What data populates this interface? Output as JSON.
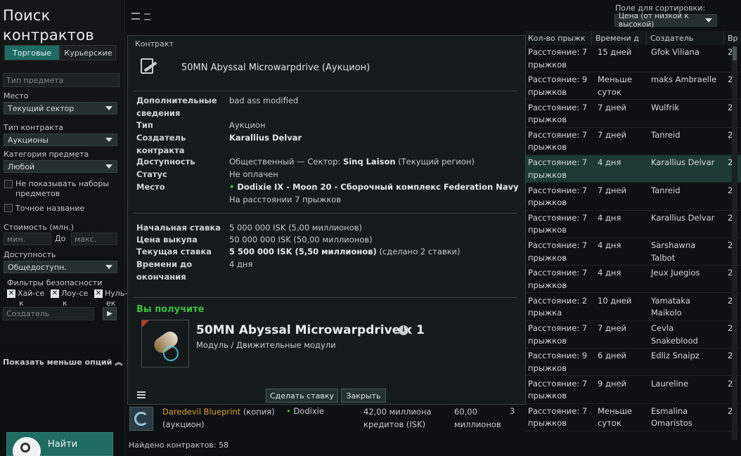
{
  "left_panel": {
    "title_line1": "Поиск",
    "title_line2": "контрактов",
    "tab_trade": "Торговые",
    "tab_courier": "Курьерские",
    "item_type_placeholder": "Тип предмета",
    "location_label": "Место",
    "location_value": "Текущий сектор",
    "contract_type_label": "Тип контракта",
    "contract_type_value": "Аукционы",
    "item_category_label": "Категория предмета",
    "item_category_value": "Любой",
    "hide_sets_line1": "Не показывать наборы",
    "hide_sets_line2": "предметов",
    "exact_name": "Точное название",
    "price_label": "Стоимость (млн.)",
    "min_placeholder": "мин.",
    "to_label": "До",
    "max_placeholder": "макс.",
    "availability_label": "Доступность",
    "availability_value": "Общедоступн.",
    "security_label": "Фильтры безопасности",
    "sec_high_1": "Хай-се",
    "sec_high_2": "к",
    "sec_low_1": "Лоу-се",
    "sec_low_2": "к",
    "sec_null_1": "Нуль-",
    "sec_null_2": "ек",
    "creator_placeholder": "Создатель",
    "show_less": "Показать меньше опций",
    "find_button": "Найти"
  },
  "sort": {
    "label": "Поле для сортировки:",
    "value": "Цена (от низкой к высокой)"
  },
  "table": {
    "headers": [
      "Кол-во прыжк",
      "Времени д",
      "Создатель",
      "Вр"
    ],
    "rows": [
      {
        "jumps1": "Расстояние: 7",
        "jumps2": "прыжков",
        "time1": "15 дней",
        "time2": "",
        "creator1": "Gfok Viliana",
        "creator2": "",
        "extra": "2"
      },
      {
        "jumps1": "Расстояние: 9",
        "jumps2": "прыжков",
        "time1": "Меньше",
        "time2": "суток",
        "creator1": "maks Ambraelle",
        "creator2": "",
        "extra": "2"
      },
      {
        "jumps1": "Расстояние: 7",
        "jumps2": "прыжков",
        "time1": "7 дней",
        "time2": "",
        "creator1": "Wulfrik",
        "creator2": "",
        "extra": "2"
      },
      {
        "jumps1": "Расстояние: 7",
        "jumps2": "прыжков",
        "time1": "7 дней",
        "time2": "",
        "creator1": "Tanreid",
        "creator2": "",
        "extra": "2"
      },
      {
        "jumps1": "Расстояние: 7",
        "jumps2": "прыжков",
        "time1": "4 дня",
        "time2": "",
        "creator1": "Karallius Delvar",
        "creator2": "",
        "extra": "2"
      },
      {
        "jumps1": "Расстояние: 7",
        "jumps2": "прыжков",
        "time1": "7 дней",
        "time2": "",
        "creator1": "Tanreid",
        "creator2": "",
        "extra": "2"
      },
      {
        "jumps1": "Расстояние: 7",
        "jumps2": "прыжков",
        "time1": "4 дня",
        "time2": "",
        "creator1": "Karallius Delvar",
        "creator2": "",
        "extra": "2"
      },
      {
        "jumps1": "Расстояние: 7",
        "jumps2": "прыжков",
        "time1": "4 дня",
        "time2": "",
        "creator1": "Sarshawna",
        "creator2": "Talbot",
        "extra": "2"
      },
      {
        "jumps1": "Расстояние: 7",
        "jumps2": "прыжков",
        "time1": "4 дня",
        "time2": "",
        "creator1": "Jeux Juegios",
        "creator2": "",
        "extra": "2"
      },
      {
        "jumps1": "Расстояние: 2",
        "jumps2": "прыжка",
        "time1": "10 дней",
        "time2": "",
        "creator1": "Yamataka",
        "creator2": "Maikolo",
        "extra": "2"
      },
      {
        "jumps1": "Расстояние: 7",
        "jumps2": "прыжков",
        "time1": "7 дней",
        "time2": "",
        "creator1": "Cevla",
        "creator2": "Snakeblood",
        "extra": "2"
      },
      {
        "jumps1": "Расстояние: 9",
        "jumps2": "прыжков",
        "time1": "6 дней",
        "time2": "",
        "creator1": "Edliz Snaipz",
        "creator2": "",
        "extra": "2"
      },
      {
        "jumps1": "Расстояние: 7",
        "jumps2": "прыжков",
        "time1": "9 дней",
        "time2": "",
        "creator1": "Laureline",
        "creator2": "",
        "extra": "2"
      },
      {
        "jumps1": "Расстояние: 7",
        "jumps2": "прыжков",
        "time1": "Меньше",
        "time2": "суток",
        "creator1": "Esmalina",
        "creator2": "Omaristos",
        "extra": "2"
      }
    ]
  },
  "bottom_row": {
    "name": "Daredevil Blueprint",
    "suffix": "(копия)",
    "type": "(аукцион)",
    "location": "Dodixie",
    "price1": "42,00 миллиона",
    "price2": "кредитов (ISK)",
    "bid1": "60,00",
    "bid2": "миллионов",
    "count": "3"
  },
  "found": "Найдено контрактов: 58",
  "modal": {
    "header": "Контракт",
    "contract_title": "50MN Abyssal Microwarpdrive (Аукцион)",
    "info_label1": "Дополнительные",
    "info_label2": "сведения",
    "info_value": "bad ass modified",
    "type_label": "Тип",
    "type_value": "Аукцион",
    "creator_label1": "Создатель",
    "creator_label2": "контракта",
    "creator_value": "Karallius Delvar",
    "access_label": "Доступность",
    "access_prefix": "Общественный — Сектор:",
    "access_region": "Sinq Laison",
    "access_suffix": "(Текущий регион)",
    "status_label": "Статус",
    "status_value": "Не оплачен",
    "place_label": "Место",
    "place_value": "Dodixie IX - Moon 20 - Сборочный комплекс Federation Navy",
    "place_distance": "На расстоянии 7 прыжков",
    "start_bid_label": "Начальная ставка",
    "start_bid_value": "5 000 000 ISK (5,00 миллионов)",
    "buyout_label": "Цена выкупа",
    "buyout_value": "50 000 000 ISK (50,00 миллионов)",
    "current_bid_label": "Текущая ставка",
    "current_bid_value": "5 500 000 ISK (5,50 миллионов)",
    "current_bid_note": "(сделано 2 ставки)",
    "time_label1": "Времени до",
    "time_label2": "окончания",
    "time_value": "4 дня",
    "you_get": "Вы получите",
    "item_name": "50MN Abyssal Microwarpdrive x 1",
    "item_category": "Модуль / Движительные модули",
    "bid_button": "Сделать ставку",
    "close_button": "Закрыть"
  },
  "colors": {
    "accent": "#1f6b62",
    "green_text": "#3fbf3f",
    "link_orange": "#d9a23a"
  }
}
